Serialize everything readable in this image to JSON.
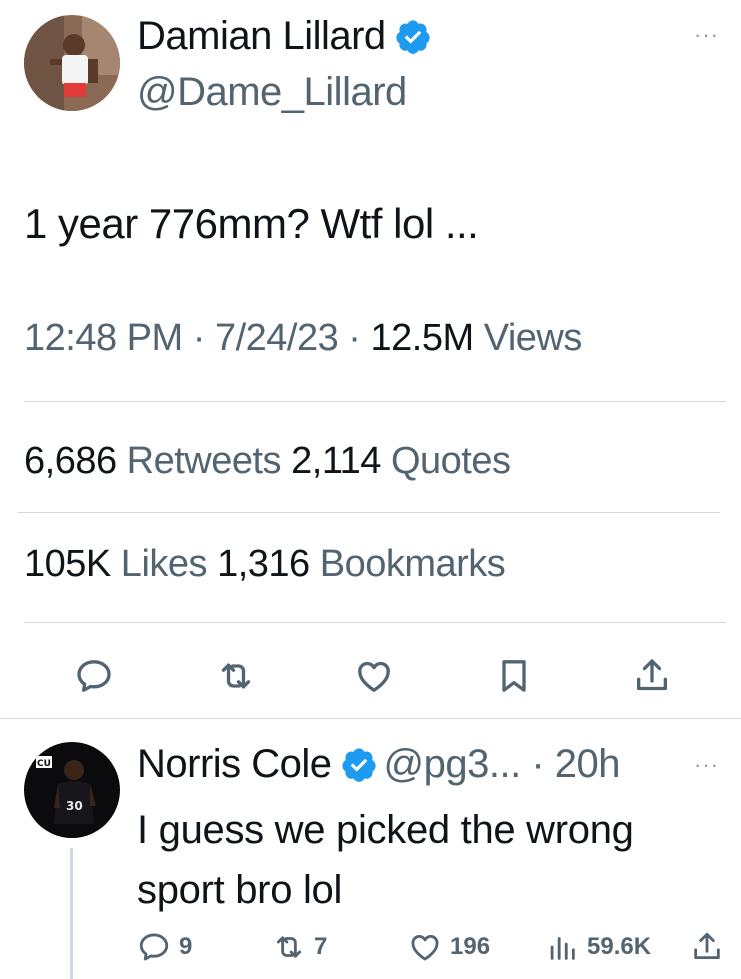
{
  "tweet": {
    "author_name": "Damian Lillard",
    "author_handle": "@Dame_Lillard",
    "more": "···",
    "text": "1 year 776mm? Wtf lol ...",
    "time": "12:48 PM",
    "sep1": " · ",
    "date": "7/24/23",
    "sep2": " · ",
    "views_count": "12.5M",
    "views_label": " Views",
    "retweets_count": "6,686",
    "retweets_label": " Retweets ",
    "quotes_count": "2,114",
    "quotes_label": " Quotes",
    "likes_count": "105K",
    "likes_label": " Likes ",
    "bookmarks_count": "1,316",
    "bookmarks_label": " Bookmarks"
  },
  "reply": {
    "author_name": "Norris Cole",
    "author_handle": "@pg3... · 20h",
    "more": "···",
    "text": "I guess we picked the wrong sport bro lol",
    "replies": "9",
    "retweets": "7",
    "likes": "196",
    "views": "59.6K"
  },
  "icons": {
    "verified": "verified-badge-icon",
    "reply": "reply-icon",
    "retweet": "retweet-icon",
    "like": "heart-icon",
    "bookmark": "bookmark-icon",
    "share": "share-icon",
    "views": "analytics-icon"
  },
  "colors": {
    "verified_blue": "#1d9bf0",
    "text_primary": "#0f1419",
    "text_secondary": "#536471",
    "divider": "#cfd9de"
  }
}
